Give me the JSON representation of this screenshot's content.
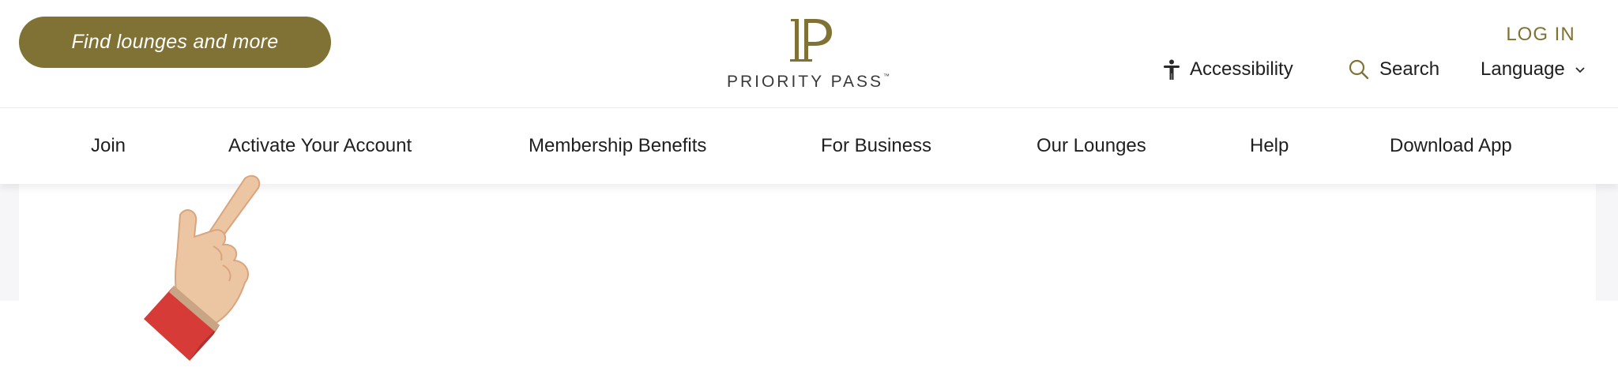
{
  "header": {
    "find_button_label": "Find lounges and more",
    "logo_text": "PRIORITY PASS",
    "logo_tm": "™",
    "login_label": "LOG IN",
    "accessibility_label": "Accessibility",
    "search_label": "Search",
    "language_label": "Language"
  },
  "nav": {
    "items": [
      {
        "label": "Join"
      },
      {
        "label": "Activate Your Account"
      },
      {
        "label": "Membership Benefits"
      },
      {
        "label": "For Business"
      },
      {
        "label": "Our Lounges"
      },
      {
        "label": "Help"
      },
      {
        "label": "Download App"
      }
    ]
  },
  "icons": {
    "logo": "priority-pass-monogram",
    "accessibility": "accessibility-person-icon",
    "search": "search-icon",
    "language_dropdown": "chevron-down-icon",
    "pointer": "pointing-hand"
  },
  "colors": {
    "brand_gold": "#7f7234",
    "text_dark": "#1f1f1f",
    "band_bg": "#f6f6f8"
  }
}
